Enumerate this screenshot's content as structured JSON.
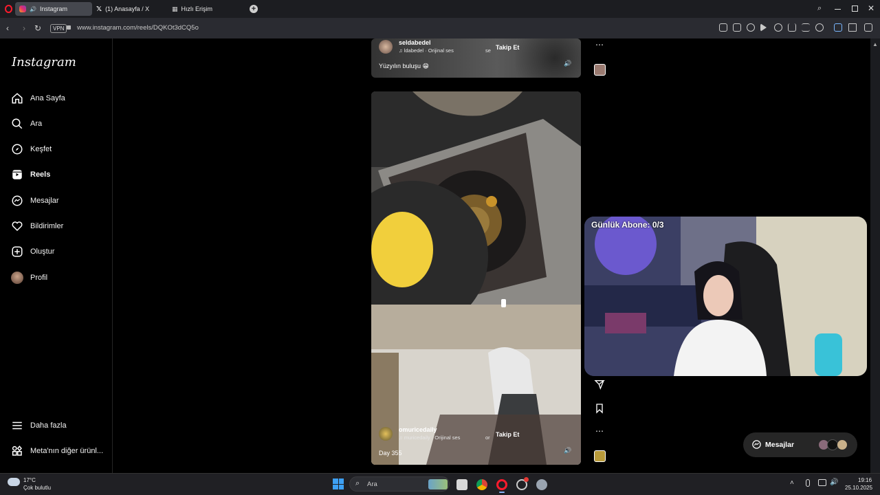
{
  "browser": {
    "tabs": [
      {
        "label": "Instagram",
        "active": true
      },
      {
        "label": "(1) Anasayfa / X",
        "active": false
      },
      {
        "label": "Hızlı Erişim",
        "active": false
      }
    ],
    "vpn_label": "VPN",
    "url": "www.instagram.com/reels/DQKOt3dCQ5o"
  },
  "instagram": {
    "logo": "Instagram",
    "nav": [
      {
        "label": "Ana Sayfa",
        "icon": "home-icon"
      },
      {
        "label": "Ara",
        "icon": "search-icon"
      },
      {
        "label": "Keşfet",
        "icon": "compass-icon"
      },
      {
        "label": "Reels",
        "icon": "reels-icon",
        "active": true
      },
      {
        "label": "Mesajlar",
        "icon": "messenger-icon"
      },
      {
        "label": "Bildirimler",
        "icon": "heart-icon"
      },
      {
        "label": "Oluştur",
        "icon": "plus-square-icon"
      },
      {
        "label": "Profil",
        "icon": "profile-avatar"
      }
    ],
    "bottom_nav": [
      {
        "label": "Daha fazla",
        "icon": "menu-icon"
      },
      {
        "label": "Meta'nın diğer ürünl...",
        "icon": "apps-icon"
      }
    ],
    "reels": [
      {
        "username": "seldabedel",
        "audio": "ldabedel · Orijinal ses",
        "audio_prefix": "se",
        "follow_label": "Takip Et",
        "caption": "Yüzyılın buluşu 😁"
      },
      {
        "username": "omuricedaily",
        "audio": "muricedaily · Orijinal ses",
        "audio_prefix": "or",
        "follow_label": "Takip Et",
        "caption": "Day 355"
      }
    ],
    "messages_button": "Mesajlar"
  },
  "overlay": {
    "label": "Günlük Abone: 0/3"
  },
  "taskbar": {
    "weather_temp": "17°C",
    "weather_desc": "Çok bulutlu",
    "search_placeholder": "Ara",
    "time": "19:16",
    "date": "25.10.2025"
  },
  "colors": {
    "ig_bg": "#000000",
    "tab_active": "#45474e",
    "addressbar": "#2a2b31",
    "opera_red": "#ff1b2d"
  }
}
